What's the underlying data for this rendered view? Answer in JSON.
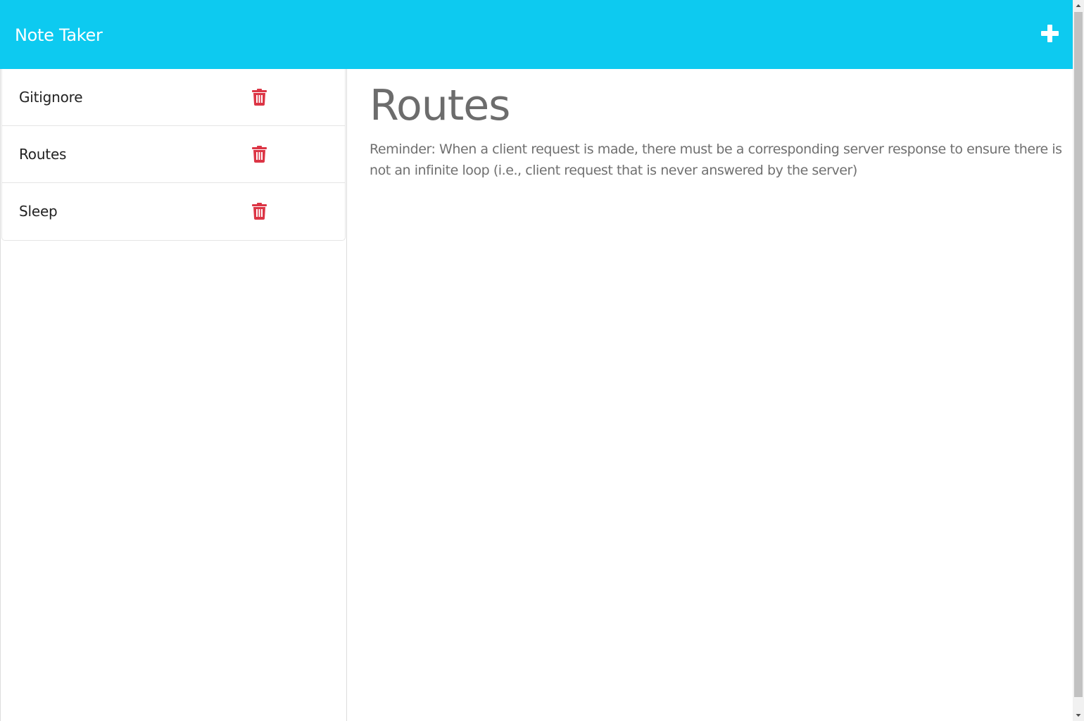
{
  "navbar": {
    "title": "Note Taker",
    "new_note_icon": "plus-icon",
    "color": "#0dcaf0"
  },
  "notes": [
    {
      "title": "Gitignore",
      "delete_icon": "trash-icon"
    },
    {
      "title": "Routes",
      "delete_icon": "trash-icon"
    },
    {
      "title": "Sleep",
      "delete_icon": "trash-icon"
    }
  ],
  "active_note": {
    "title": "Routes",
    "text": "Reminder: When a client request is made, there must be a corresponding server response to ensure there is not an infinite loop (i.e., client request that is never answered by the server)"
  },
  "colors": {
    "delete": "#dc3545",
    "text_muted": "#6c6c6c"
  }
}
